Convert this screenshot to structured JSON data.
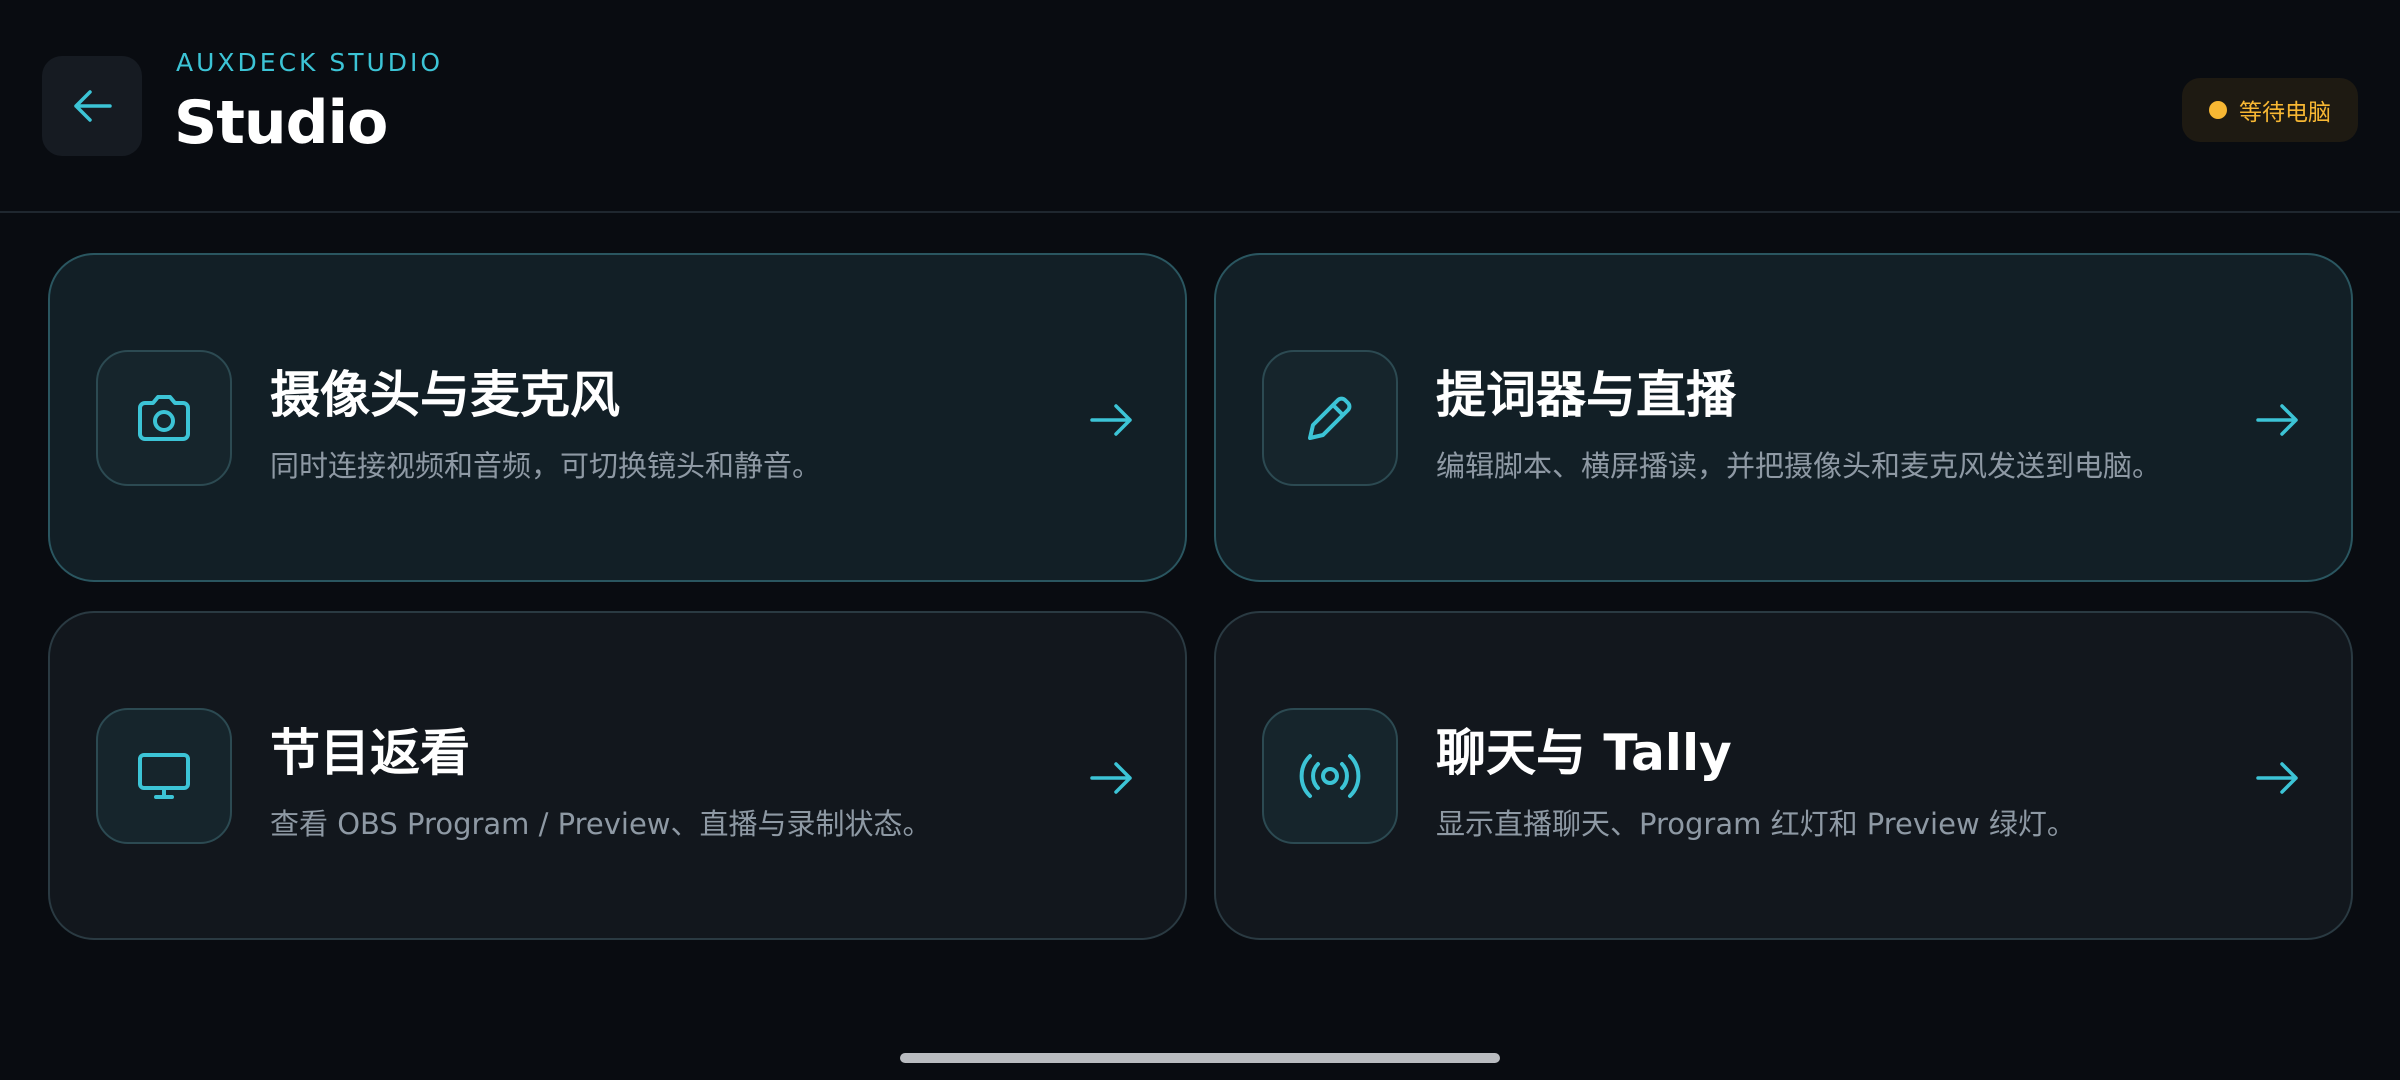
{
  "header": {
    "brand": "AUXDECK STUDIO",
    "title": "Studio",
    "status": "等待电脑"
  },
  "cards": [
    {
      "title": "摄像头与麦克风",
      "description": "同时连接视频和音频，可切换镜头和静音。",
      "icon": "camera-icon",
      "highlighted": true
    },
    {
      "title": "提词器与直播",
      "description": "编辑脚本、横屏播读，并把摄像头和麦克风发送到电脑。",
      "icon": "pencil-icon",
      "highlighted": true
    },
    {
      "title": "节目返看",
      "description": "查看 OBS Program / Preview、直播与录制状态。",
      "icon": "monitor-icon",
      "highlighted": false
    },
    {
      "title": "聊天与 Tally",
      "description": "显示直播聊天、Program 红灯和 Preview 绿灯。",
      "icon": "broadcast-icon",
      "highlighted": false
    }
  ],
  "colors": {
    "accent": "#3cc4d6",
    "background": "#090c11",
    "status_warning": "#f7b733"
  }
}
